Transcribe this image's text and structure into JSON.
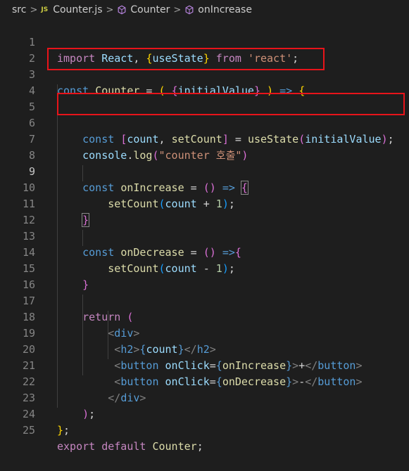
{
  "breadcrumb": {
    "folder": "src",
    "file_type_badge": "JS",
    "file": "Counter.js",
    "symbol1": "Counter",
    "symbol2": "onIncrease",
    "separator": ">"
  },
  "icons": {
    "separator": "chevron-right-icon",
    "file": "javascript-file-icon",
    "symbol": "symbol-method-icon"
  },
  "active_line": 9,
  "annotation_color": "#e8141a",
  "lines": [
    {
      "n": "1"
    },
    {
      "n": "2"
    },
    {
      "n": "3"
    },
    {
      "n": "4"
    },
    {
      "n": "5"
    },
    {
      "n": "6"
    },
    {
      "n": "7"
    },
    {
      "n": "8"
    },
    {
      "n": "9"
    },
    {
      "n": "10"
    },
    {
      "n": "11"
    },
    {
      "n": "12"
    },
    {
      "n": "13"
    },
    {
      "n": "14"
    },
    {
      "n": "15"
    },
    {
      "n": "16"
    },
    {
      "n": "17"
    },
    {
      "n": "18"
    },
    {
      "n": "19"
    },
    {
      "n": "20"
    },
    {
      "n": "21"
    },
    {
      "n": "22"
    },
    {
      "n": "23"
    },
    {
      "n": "24"
    },
    {
      "n": "25"
    }
  ],
  "code": {
    "l1": {
      "import": "import",
      "react": "React",
      "comma": ", ",
      "open": "{",
      "usestate": "useState",
      "close": "}",
      "from": " from ",
      "mod": "'react'",
      "semi": ";"
    },
    "l3": {
      "const": "const",
      "name": "Counter",
      "eq": " = ",
      "paren_open": "(",
      "brace_open": "{",
      "param": "initialValue",
      "brace_close": "}",
      "paren_close": ")",
      "arrow": "=>",
      "body_open": "{"
    },
    "l6": {
      "const": "const",
      "bracket_open": "[",
      "count": "count",
      "comma": ", ",
      "setcount": "setCount",
      "bracket_close": "]",
      "eq": " = ",
      "fn": "useState",
      "paren_open": "(",
      "arg": "initialValue",
      "paren_close": ")",
      "semi": ";"
    },
    "l7": {
      "obj": "console",
      "dot": ".",
      "fn": "log",
      "paren_open": "(",
      "str": "\"counter 호출\"",
      "paren_close": ")"
    },
    "l9": {
      "const": "const",
      "name": "onIncrease",
      "eq": " = ",
      "parens": "()",
      "arrow": "=>",
      "brace": "{"
    },
    "l10": {
      "fn": "setCount",
      "paren_open": "(",
      "var": "count",
      "op": " + ",
      "num": "1",
      "paren_close": ")",
      "semi": ";"
    },
    "l11": {
      "brace": "}"
    },
    "l13": {
      "const": "const",
      "name": "onDecrease",
      "eq": " = ",
      "parens": "()",
      "arrow": "=>",
      "brace": "{"
    },
    "l14": {
      "fn": "setCount",
      "paren_open": "(",
      "var": "count",
      "op": " - ",
      "num": "1",
      "paren_close": ")",
      "semi": ";"
    },
    "l15": {
      "brace": "}"
    },
    "l17": {
      "ret": "return",
      "paren": "("
    },
    "l18": {
      "lt": "<",
      "tag": "div",
      "gt": ">"
    },
    "l19": {
      "lt": "<",
      "tag": "h2",
      "gt": ">",
      "brace_open": "{",
      "var": "count",
      "brace_close": "}",
      "lt2": "</",
      "tag2": "h2",
      "gt2": ">"
    },
    "l20": {
      "lt": "<",
      "tag": "button",
      "attr": "onClick",
      "eq": "=",
      "brace_open": "{",
      "var": "onIncrease",
      "brace_close": "}",
      "gt": ">",
      "text": "+",
      "lt2": "</",
      "tag2": "button",
      "gt2": ">"
    },
    "l21": {
      "lt": "<",
      "tag": "button",
      "attr": "onClick",
      "eq": "=",
      "brace_open": "{",
      "var": "onDecrease",
      "brace_close": "}",
      "gt": ">",
      "text": "-",
      "lt2": "</",
      "tag2": "button",
      "gt2": ">"
    },
    "l22": {
      "lt": "</",
      "tag": "div",
      "gt": ">"
    },
    "l23": {
      "paren": ")",
      "semi": ";"
    },
    "l24": {
      "brace": "}",
      "semi": ";"
    },
    "l25": {
      "export": "export",
      "default": "default",
      "name": "Counter",
      "semi": ";"
    }
  }
}
